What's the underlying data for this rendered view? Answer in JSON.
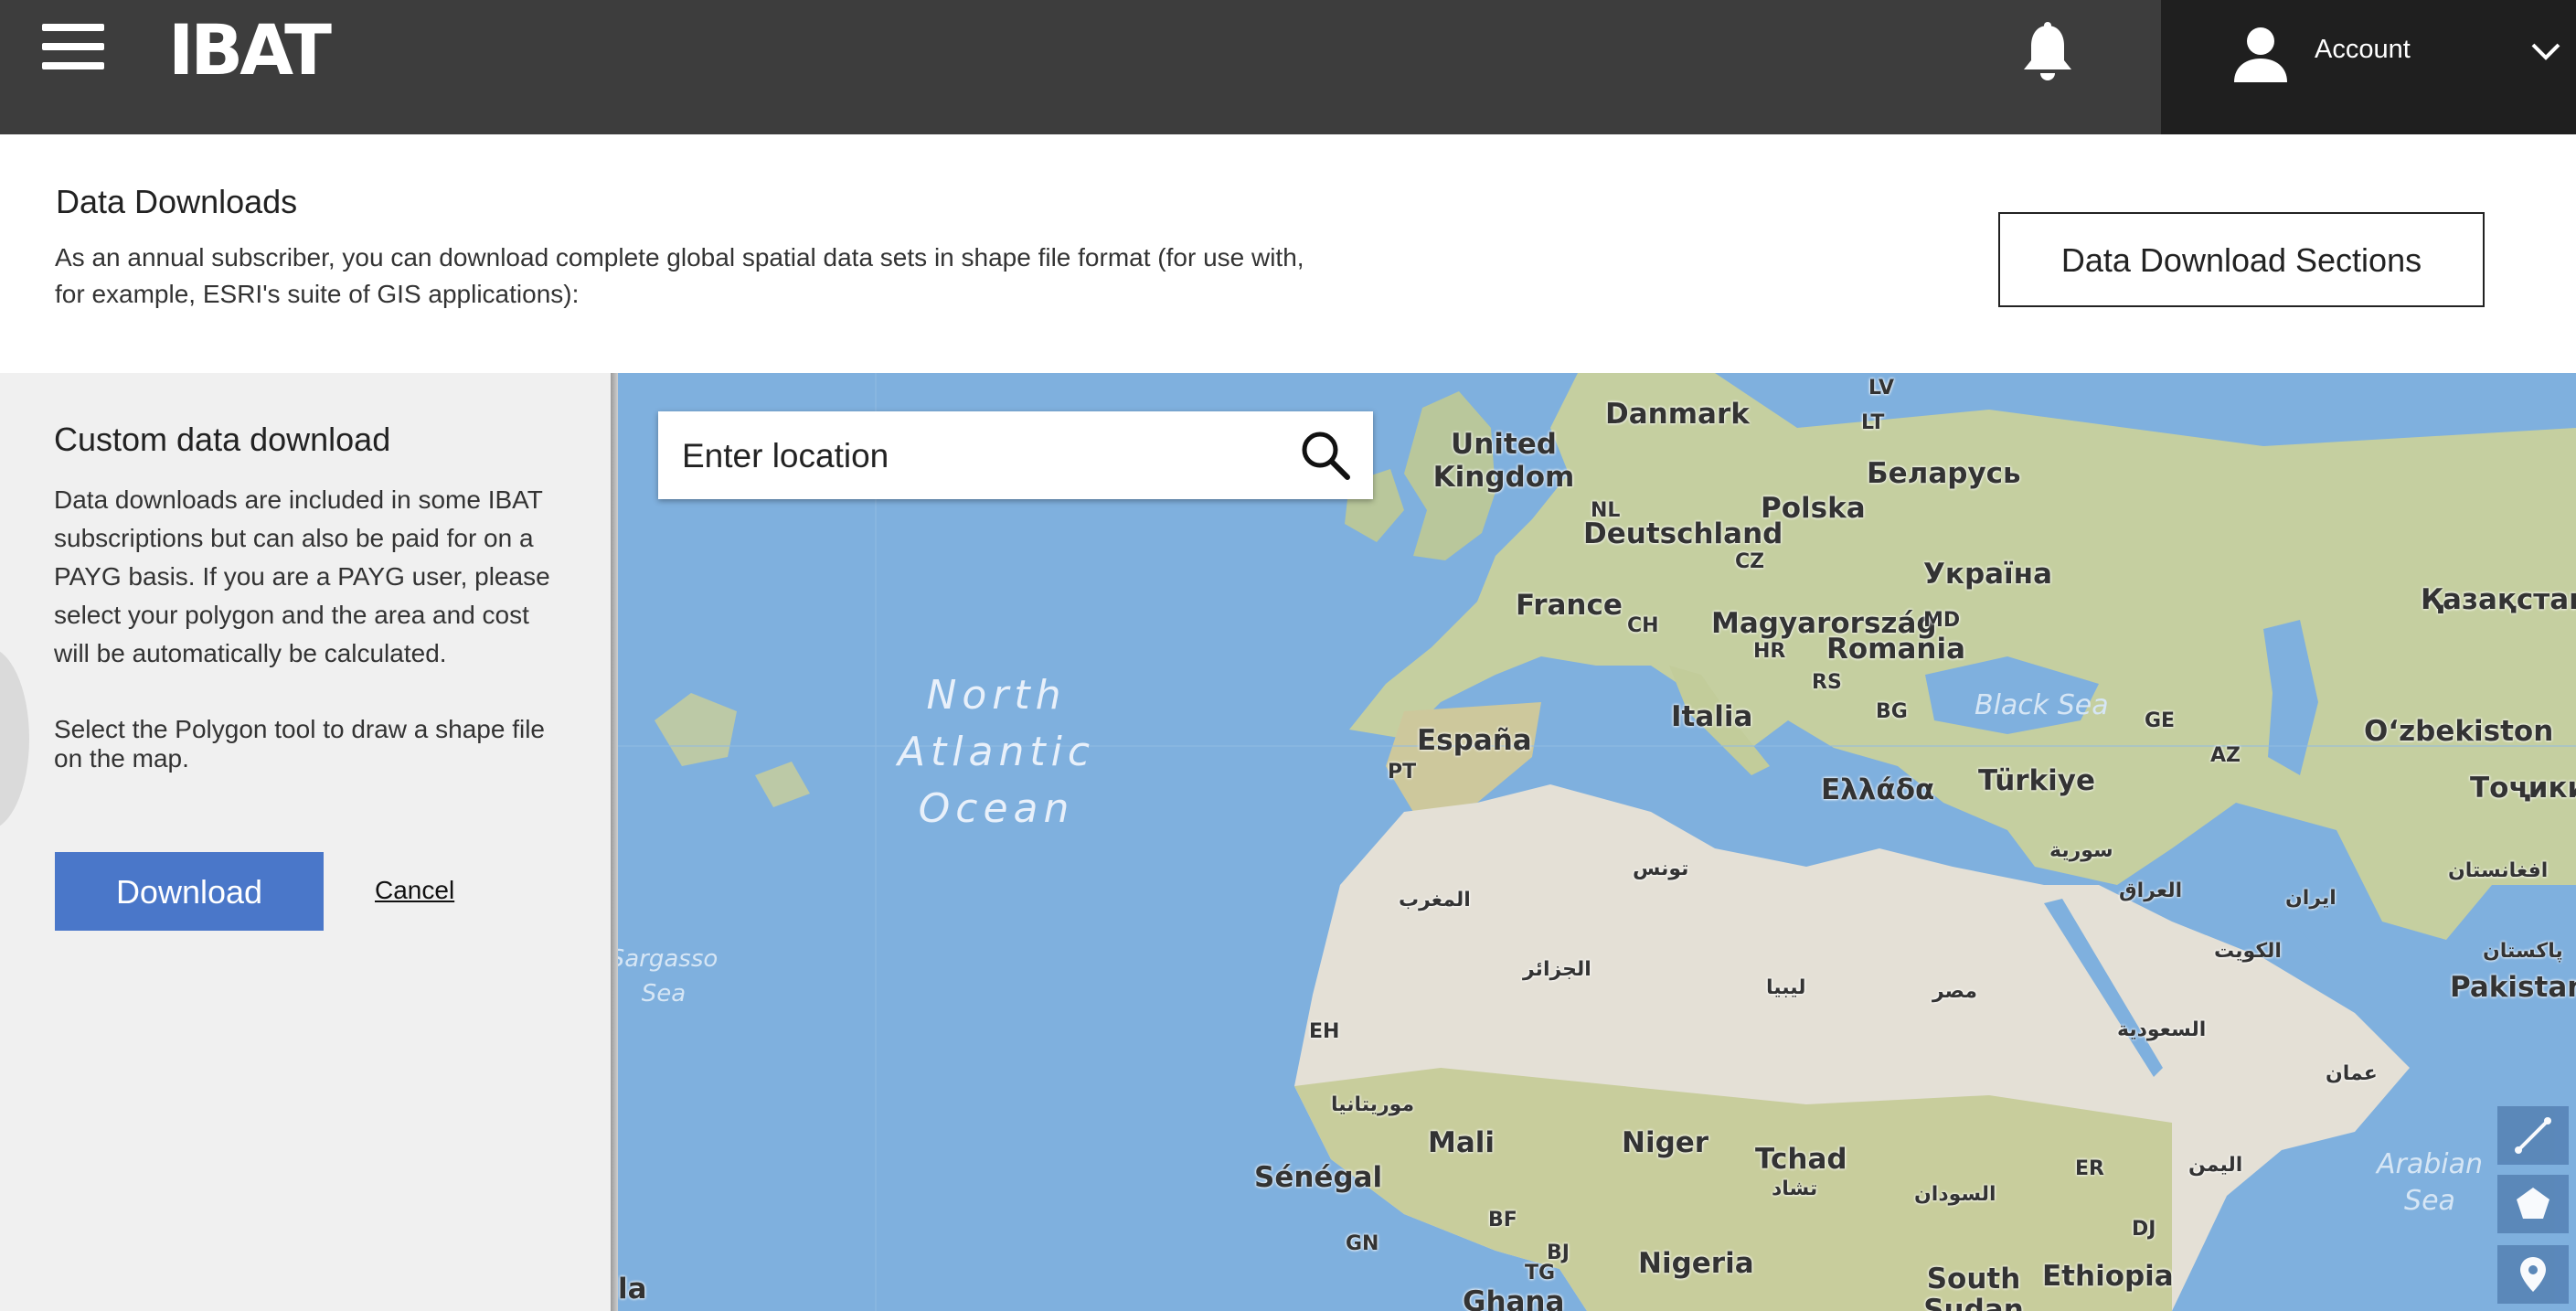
{
  "header": {
    "logo_text": "IBAT",
    "account_label": "Account"
  },
  "intro": {
    "title": "Data Downloads",
    "description": "As an annual subscriber, you can download complete global spatial data sets in shape file format (for use with, for example, ESRI's suite of GIS applications):",
    "sections_button": "Data Download Sections"
  },
  "panel": {
    "title": "Custom data download",
    "text": "Data downloads are included in some IBAT subscriptions but can also be paid for on a PAYG basis. If you are a PAYG user, please select your polygon and the area and cost will be automatically be calculated.",
    "instruction": "Select the Polygon tool to draw a shape file on the map.",
    "download_label": "Download",
    "cancel_label": "Cancel"
  },
  "search": {
    "placeholder": "Enter location"
  },
  "map": {
    "labels": [
      "Danmark",
      "LV",
      "LT",
      "United Kingdom",
      "Беларусь",
      "NL",
      "Polska",
      "Deutschland",
      "CZ",
      "Україна",
      "France",
      "CH",
      "Magyarország",
      "MD",
      "HR",
      "Romania",
      "RS",
      "BG",
      "Italia",
      "Black Sea",
      "GE",
      "AZ",
      "Қазақстан",
      "Oʻzbekiston",
      "España",
      "PT",
      "Ελλάδα",
      "Türkiye",
      "Тоҷики",
      "North Atlantic Ocean",
      "تونس",
      "سورية",
      "العراق",
      "ایران",
      "افغانستان",
      "المغرب",
      "الجزائر",
      "ليبيا",
      "مصر",
      "الكويت",
      "پاکستان",
      "Pakistan",
      "Sargasso Sea",
      "EH",
      "السعودية",
      "عمان",
      "موريتانيا",
      "Mali",
      "Niger",
      "Tchad",
      "تشاد",
      "ER",
      "اليمن",
      "Arabian Sea",
      "Sénégal",
      "BF",
      "GN",
      "BJ",
      "TG",
      "Nigeria",
      "السودان",
      "DJ",
      "South Sudan",
      "Ethiopia",
      "Ghana",
      "la"
    ]
  },
  "colors": {
    "topbar": "#3d3d3d",
    "account_bg": "#1f1f1f",
    "download_button": "#4a77c9",
    "ocean": "#7fb0de",
    "land": "#e4e0d6",
    "panel_bg": "#f0f0f0"
  },
  "icons": {
    "menu": "hamburger-icon",
    "notifications": "bell-icon",
    "account": "user-icon",
    "dropdown": "chevron-down-icon",
    "search": "search-icon",
    "line_tool": "line-icon",
    "polygon_tool": "pentagon-icon",
    "marker_tool": "marker-icon"
  }
}
